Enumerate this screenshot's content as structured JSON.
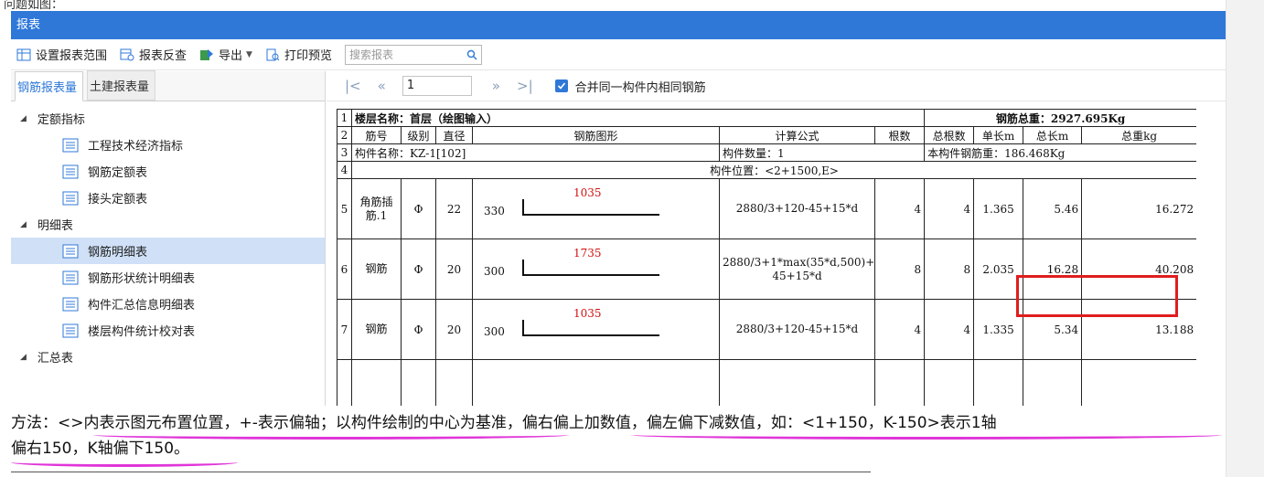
{
  "outer_top_text": "问题如图：",
  "window": {
    "title": "报表"
  },
  "toolbar": {
    "set_range": "设置报表范围",
    "reverse_lookup": "报表反查",
    "export": "导出",
    "print_preview": "打印预览",
    "search_placeholder": "搜索报表"
  },
  "left_tabs": {
    "rebar": "钢筋报表量",
    "civil": "土建报表量"
  },
  "tree": {
    "g1": "定额指标",
    "g1_items": [
      "工程技术经济指标",
      "钢筋定额表",
      "接头定额表"
    ],
    "g2": "明细表",
    "g2_items": [
      "钢筋明细表",
      "钢筋形状统计明细表",
      "构件汇总信息明细表",
      "楼层构件统计校对表"
    ],
    "g3": "汇总表"
  },
  "pager": {
    "page": "1",
    "merge_label": "合并同一构件内相同钢筋"
  },
  "report": {
    "floor_name": "楼层名称：首层（绘图输入）",
    "total_weight": "钢筋总重：2927.695Kg",
    "headers": [
      "筋号",
      "级别",
      "直径",
      "钢筋图形",
      "计算公式",
      "根数",
      "总根数",
      "单长m",
      "总长m",
      "总重kg"
    ],
    "component_name": "构件名称：KZ-1[102]",
    "component_count": "构件数量：1",
    "component_weight": "本构件钢筋重：186.468Kg",
    "component_position": "构件位置：<2+1500,E>",
    "rows": [
      {
        "no": "5",
        "name": "角筋插筋.1",
        "grade": "Φ",
        "dia": "22",
        "left": "330",
        "shape_red": "1035",
        "formula": "2880/3+120-45+15*d",
        "count": "4",
        "total_count": "4",
        "unit_len": "1.365",
        "total_len": "5.46",
        "total_wt": "16.272"
      },
      {
        "no": "6",
        "name": "钢筋",
        "grade": "Φ",
        "dia": "20",
        "left": "300",
        "shape_red": "1735",
        "formula": "2880/3+1*max(35*d,500)+120-45+15*d",
        "count": "8",
        "total_count": "8",
        "unit_len": "2.035",
        "total_len": "16.28",
        "total_wt": "40.208"
      },
      {
        "no": "7",
        "name": "钢筋",
        "grade": "Φ",
        "dia": "20",
        "left": "300",
        "shape_red": "1035",
        "formula": "2880/3+120-45+15*d",
        "count": "4",
        "total_count": "4",
        "unit_len": "1.335",
        "total_len": "5.34",
        "total_wt": "13.188"
      }
    ]
  },
  "note": {
    "line1": "方法：<>内表示图元布置位置，+-表示偏轴；以构件绘制的中心为基准，偏右偏上加数值，偏左偏下减数值，如：<1+150，K-150>表示1轴",
    "line2": "偏右150，K轴偏下150。"
  },
  "colors": {
    "title_bar": "#2f78d8",
    "highlight": "#e01d1d",
    "annotation": "#e035d8",
    "shape_red": "#d21010"
  }
}
